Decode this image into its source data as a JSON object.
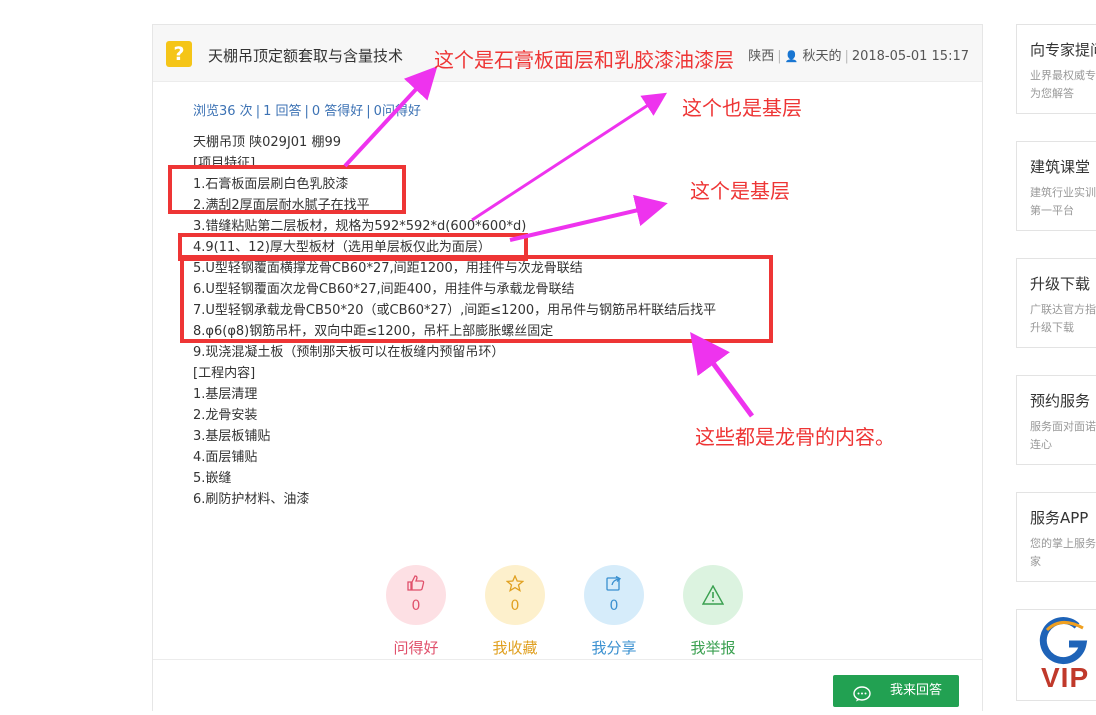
{
  "question": {
    "icon": "question-icon",
    "icon_glyph": "?",
    "title": "天棚吊顶定额套取与含量技术",
    "category": "陕西",
    "author": "秋天的",
    "datetime": "2018-05-01 15:17",
    "stats": {
      "views": "浏览36 次",
      "answers": "1 回答",
      "likes": "0 答得好",
      "asks": "0问得好"
    }
  },
  "body_lines": [
    "天棚吊顶 陕029J01 棚99",
    "[项目特征]",
    "1.石膏板面层刷白色乳胶漆",
    "2.满刮2厚面层耐水腻子在找平",
    "3.错缝粘贴第二层板材，规格为592*592*d(600*600*d)",
    "4.9(11、12)厚大型板材（选用单层板仅此为面层）",
    "5.U型轻钢覆面横撑龙骨CB60*27,间距1200，用挂件与次龙骨联结",
    "6.U型轻钢覆面次龙骨CB60*27,间距400，用挂件与承载龙骨联结",
    "7.U型轻钢承载龙骨CB50*20（或CB60*27）,间距≤1200，用吊件与钢筋吊杆联结后找平",
    "8.φ6(φ8)钢筋吊杆，双向中距≤1200，吊杆上部膨胀螺丝固定",
    "9.现浇混凝土板（预制那天板可以在板缝内预留吊环）",
    "[工程内容]",
    "1.基层清理",
    "2.龙骨安装",
    "3.基层板铺贴",
    "4.面层铺贴",
    "5.嵌缝",
    "6.刷防护材料、油漆"
  ],
  "actions": [
    {
      "label": "问得好",
      "count": "0",
      "icon": "thumbs-up-icon",
      "glyph": "👍",
      "color": "#e0506b",
      "bg": "#fde0e4"
    },
    {
      "label": "我收藏",
      "count": "0",
      "icon": "star-icon",
      "glyph": "☆",
      "color": "#e0a020",
      "bg": "#fdf0cc"
    },
    {
      "label": "我分享",
      "count": "0",
      "icon": "share-icon",
      "glyph": "⇪",
      "color": "#3a90d0",
      "bg": "#d6ecfa"
    },
    {
      "label": "我举报",
      "count": "",
      "icon": "warning-icon",
      "glyph": "⚠",
      "color": "#3aa050",
      "bg": "#dcf3e0"
    }
  ],
  "answer_button": {
    "label": "我来回答",
    "icon": "chat-bubble-icon",
    "color": "#22a152"
  },
  "sidebar": [
    {
      "title": "向专家提问",
      "desc": "业界最权威专家为您解答"
    },
    {
      "title": "建筑课堂",
      "desc": "建筑行业实训学第一平台"
    },
    {
      "title": "升级下载",
      "desc": "广联达官方指定升级下载"
    },
    {
      "title": "预约服务",
      "desc": "服务面对面诺心连心"
    },
    {
      "title": "服务APP",
      "desc": "您的掌上服务专家"
    }
  ],
  "logo_text": "VIP",
  "annotations": {
    "a1": "这个是石膏板面层和乳胶漆油漆层",
    "a2": "这个也是基层",
    "a3": "这个是基层",
    "a4": "这些都是龙骨的内容。"
  },
  "colors": {
    "annotation": "#ee3535",
    "arrow": "#ee33ee",
    "link": "#3c72b4"
  }
}
